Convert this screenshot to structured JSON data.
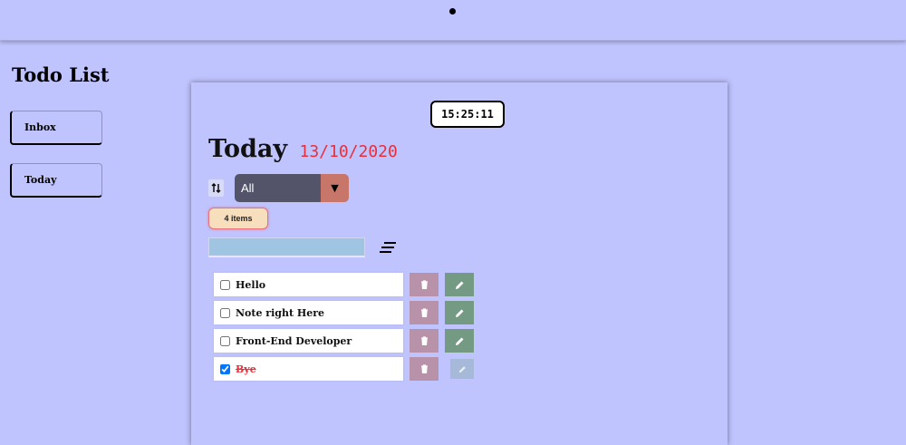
{
  "app": {
    "title": "Todo List"
  },
  "nav": {
    "items": [
      {
        "label": "Inbox"
      },
      {
        "label": "Today"
      }
    ]
  },
  "clock": {
    "time": "15:25:11"
  },
  "page": {
    "title": "Today",
    "date": "13/10/2020"
  },
  "filter": {
    "selected": "All",
    "arrow": "▼"
  },
  "count": {
    "label": "4 items"
  },
  "search": {
    "value": "",
    "placeholder": ""
  },
  "todos": [
    {
      "text": "Hello",
      "done": false
    },
    {
      "text": "Note right Here",
      "done": false
    },
    {
      "text": "Front-End Developer",
      "done": false
    },
    {
      "text": "Bye",
      "done": true
    }
  ],
  "icons": {
    "sort": "sort-arrows-icon",
    "filter": "filter-lines-icon",
    "delete": "trash-icon",
    "edit": "pencil-icon"
  },
  "colors": {
    "background": "#c0c4fe",
    "date": "#e6303c",
    "select": "#53546a",
    "select_arrow": "#c77669",
    "delete_button": "#b792a9",
    "edit_button": "#749a84",
    "edit_button_disabled": "#a6b9d8",
    "search_input": "#a0c5e3",
    "badge": "#f7dfbd"
  }
}
